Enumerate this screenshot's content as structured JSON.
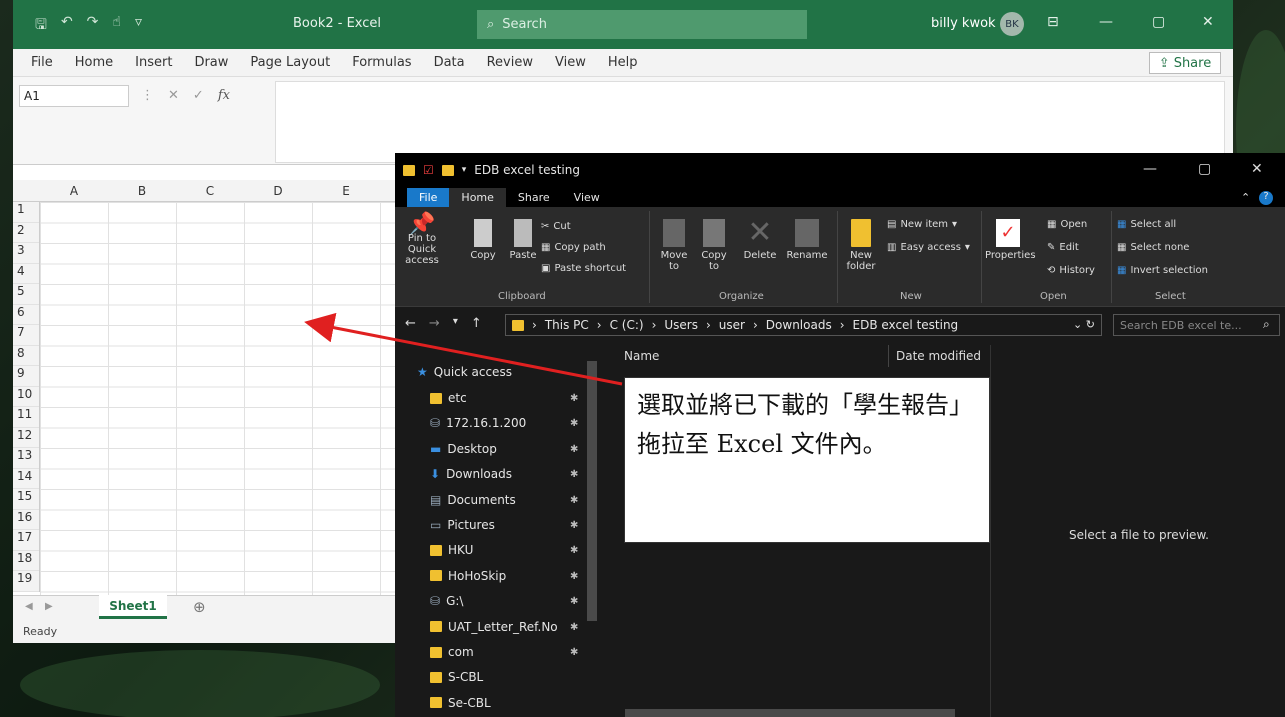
{
  "excel": {
    "doc_title": "Book2 - Excel",
    "search_label": "Search",
    "user_name": "billy kwok",
    "user_initials": "BK",
    "menu": [
      "File",
      "Home",
      "Insert",
      "Draw",
      "Page Layout",
      "Formulas",
      "Data",
      "Review",
      "View",
      "Help"
    ],
    "share_label": "Share",
    "name_box": "A1",
    "fx_label": "fx",
    "columns": [
      "A",
      "B",
      "C",
      "D",
      "E"
    ],
    "rows": [
      "1",
      "2",
      "3",
      "4",
      "5",
      "6",
      "7",
      "8",
      "9",
      "10",
      "11",
      "12",
      "13",
      "14",
      "15",
      "16",
      "17",
      "18",
      "19"
    ],
    "sheet_tab": "Sheet1",
    "status": "Ready"
  },
  "explorer": {
    "title": "EDB excel testing",
    "tabs": [
      "File",
      "Home",
      "Share",
      "View"
    ],
    "clipboard": {
      "pin_label": "Pin to Quick access",
      "copy_label": "Copy",
      "paste_label": "Paste",
      "cut_label": "Cut",
      "copy_path_label": "Copy path",
      "paste_shortcut_label": "Paste shortcut",
      "group": "Clipboard"
    },
    "organize": {
      "move_to": "Move to",
      "copy_to": "Copy to",
      "delete": "Delete",
      "rename": "Rename",
      "group": "Organize"
    },
    "new": {
      "new_folder": "New folder",
      "new_item": "New item",
      "easy_access": "Easy access",
      "group": "New"
    },
    "open": {
      "properties": "Properties",
      "open": "Open",
      "edit": "Edit",
      "history": "History",
      "group": "Open"
    },
    "select": {
      "select_all": "Select all",
      "select_none": "Select none",
      "invert": "Invert selection",
      "group": "Select"
    },
    "breadcrumb": [
      "This PC",
      "C (C:)",
      "Users",
      "user",
      "Downloads",
      "EDB excel testing"
    ],
    "search_placeholder": "Search EDB excel te...",
    "quick_access": "Quick access",
    "nav_items": [
      {
        "label": "etc",
        "pinned": true
      },
      {
        "label": "172.16.1.200",
        "pinned": true
      },
      {
        "label": "Desktop",
        "pinned": true
      },
      {
        "label": "Downloads",
        "pinned": true
      },
      {
        "label": "Documents",
        "pinned": true
      },
      {
        "label": "Pictures",
        "pinned": true
      },
      {
        "label": "HKU",
        "pinned": true
      },
      {
        "label": "HoHoSkip",
        "pinned": true
      },
      {
        "label": "G:\\",
        "pinned": true
      },
      {
        "label": "UAT_Letter_Ref.No",
        "pinned": true
      },
      {
        "label": "com",
        "pinned": true
      },
      {
        "label": "S-CBL",
        "pinned": false
      },
      {
        "label": "Se-CBL",
        "pinned": false
      }
    ],
    "col_name": "Name",
    "col_date": "Date modified",
    "preview_text": "Select a file to preview."
  },
  "callout": {
    "text": "選取並將已下載的「學生報告」拖拉至 Excel 文件內。"
  },
  "colors": {
    "excel_green": "#217346",
    "arrow_red": "#e02020",
    "explorer_bg": "#191919",
    "folder_yellow": "#f0c030",
    "accent_blue": "#1979ca"
  }
}
